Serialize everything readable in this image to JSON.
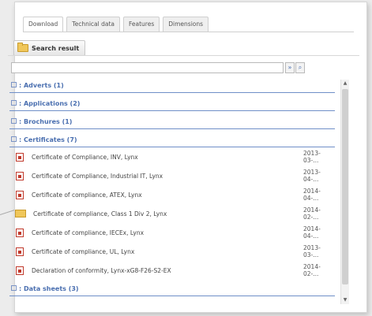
{
  "tabs": [
    "Download",
    "Technical data",
    "Features",
    "Dimensions"
  ],
  "search_result_label": "Search result",
  "search": {
    "value": "",
    "clear_glyph": "»",
    "go_glyph": "⌕"
  },
  "groups": [
    {
      "label": "Adverts (1)"
    },
    {
      "label": "Applications (2)"
    },
    {
      "label": "Brochures (1)"
    },
    {
      "label": "Certificates (7)"
    },
    {
      "label": "Data sheets (3)"
    }
  ],
  "certificates": [
    {
      "name": "Certificate of Compliance, INV, Lynx",
      "date": "2013-03-...",
      "icon": "pdf-icon"
    },
    {
      "name": "Certificate of Compliance, Industrial IT, Lynx",
      "date": "2013-04-...",
      "icon": "pdf-icon"
    },
    {
      "name": "Certificate of compliance, ATEX, Lynx",
      "date": "2014-04-...",
      "icon": "pdf-icon"
    },
    {
      "name": "Certificate of compliance, Class 1 Div 2, Lynx",
      "date": "2014-02-...",
      "icon": "folder-icon"
    },
    {
      "name": "Certificate of compliance, IECEx, Lynx",
      "date": "2014-04-...",
      "icon": "pdf-icon"
    },
    {
      "name": "Certificate of compliance, UL, Lynx",
      "date": "2013-03-...",
      "icon": "pdf-icon"
    },
    {
      "name": "Declaration of conformity, Lynx-xG8-F26-S2-EX",
      "date": "2014-02-...",
      "icon": "pdf-icon"
    }
  ],
  "colors": {
    "group_link": "#4a6fb0",
    "pdf_red": "#c0392b",
    "folder": "#f0c75a"
  }
}
